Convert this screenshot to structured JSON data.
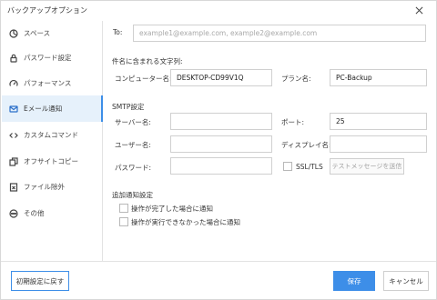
{
  "window": {
    "title": "バックアップオプション"
  },
  "sidebar": {
    "items": [
      {
        "label": "スペース"
      },
      {
        "label": "パスワード設定"
      },
      {
        "label": "パフォーマンス"
      },
      {
        "label": "Eメール通知"
      },
      {
        "label": "カスタムコマンド"
      },
      {
        "label": "オフサイトコピー"
      },
      {
        "label": "ファイル除外"
      },
      {
        "label": "その他"
      }
    ],
    "active_index": 3
  },
  "email": {
    "to_label": "To:",
    "to_placeholder": "example1@example.com, example2@example.com",
    "subject_section": "件名に含まれる文字列:",
    "computer_name_label": "コンピューター名:",
    "computer_name_value": "DESKTOP-CD99V1Q",
    "plan_name_label": "プラン名:",
    "plan_name_value": "PC-Backup"
  },
  "smtp": {
    "section": "SMTP設定",
    "server_label": "サーバー名:",
    "server_value": "",
    "port_label": "ポート:",
    "port_value": "25",
    "username_label": "ユーザー名:",
    "username_value": "",
    "display_name_label": "ディスプレイ名:",
    "display_name_value": "",
    "password_label": "パスワード:",
    "password_value": "",
    "ssl_label": "SSL/TLS",
    "ssl_checked": false,
    "test_button": "テストメッセージを送信"
  },
  "additional": {
    "section": "追加通知設定",
    "on_complete": "操作が完了した場合に通知",
    "on_complete_checked": false,
    "on_fail": "操作が実行できなかった場合に通知",
    "on_fail_checked": false
  },
  "footer": {
    "reset_button": "初期設定に戻す",
    "save_button": "保存",
    "cancel_button": "キャンセル"
  },
  "colors": {
    "accent": "#3d8ee8",
    "active_nav_bg": "#e6f1fb",
    "border": "#d0d0d0"
  },
  "icons": {
    "close": "close-icon",
    "nav": [
      "space-icon",
      "lock-icon",
      "performance-icon",
      "email-icon",
      "code-icon",
      "offsite-copy-icon",
      "file-exclude-icon",
      "other-icon"
    ]
  }
}
